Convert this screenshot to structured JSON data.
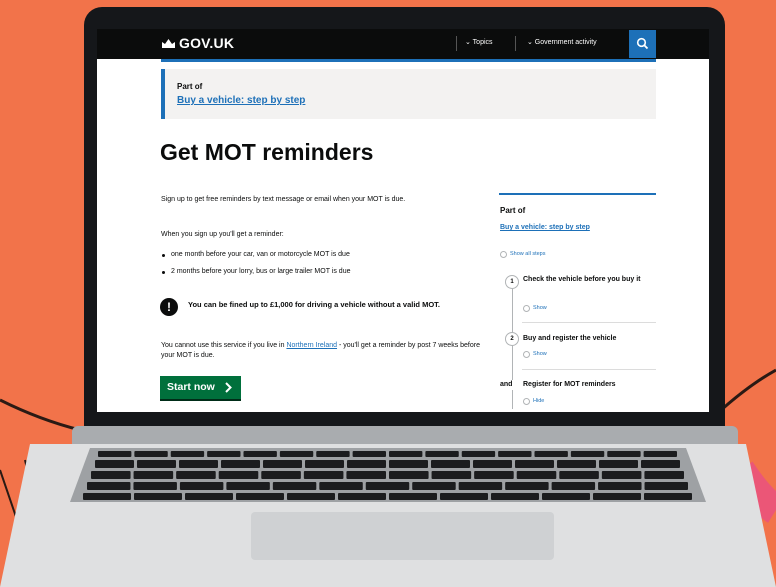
{
  "header": {
    "logo_text": "GOV.UK",
    "nav": {
      "topics": "⌄ Topics",
      "government_activity": "⌄ Government activity"
    }
  },
  "breadcrumb_banner": {
    "label": "Part of",
    "link": "Buy a vehicle: step by step"
  },
  "main": {
    "title": "Get MOT reminders",
    "intro": "Sign up to get free reminders by text message or email when your MOT is due.",
    "when_label": "When you sign up you'll get a reminder:",
    "bullets": [
      "one month before your car, van or motorcycle MOT is due",
      "2 months before your lorry, bus or large trailer MOT is due"
    ],
    "warning": "You can be fined up to £1,000 for driving a vehicle without a valid MOT.",
    "cannot": {
      "before": "You cannot use this service if you live in ",
      "link": "Northern Ireland",
      "after": " - you'll get a reminder by post 7 weeks before your MOT is due."
    },
    "start_button": "Start now"
  },
  "sidebar": {
    "part_of": "Part of",
    "link": "Buy a vehicle: step by step",
    "show_all": "Show all steps",
    "steps": [
      {
        "marker": "1",
        "title": "Check the vehicle before you buy it",
        "toggle": "Show"
      },
      {
        "marker": "2",
        "title": "Buy and register the vehicle",
        "toggle": "Show"
      },
      {
        "marker": "and",
        "title": "Register for MOT reminders",
        "toggle": "Hide"
      }
    ]
  },
  "colors": {
    "background": "#f2734a",
    "govuk_black": "#0b0c0c",
    "link_blue": "#1d70b8",
    "start_green": "#00703c"
  }
}
